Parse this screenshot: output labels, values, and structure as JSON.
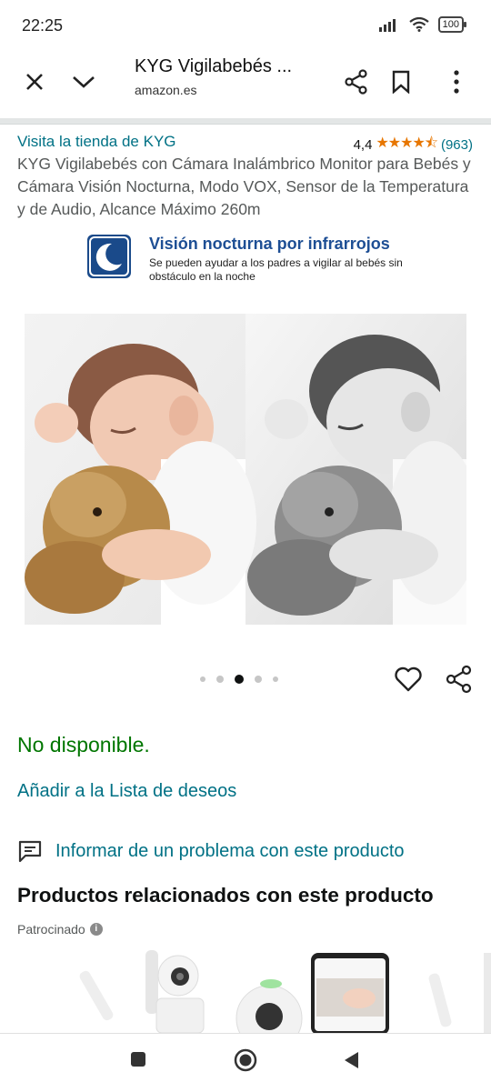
{
  "status_bar": {
    "time": "22:25",
    "battery": "100"
  },
  "browser": {
    "page_title": "KYG Vigilabebés ...",
    "domain": "amazon.es"
  },
  "product": {
    "store_link": "Visita la tienda de KYG",
    "rating_value": "4,4",
    "rating_stars": "★★★★⯪",
    "rating_count": "(963)",
    "title": "KYG Vigilabebés con Cámara Inalámbrico Monitor para Bebés y Cámara Visión Nocturna, Modo VOX, Sensor de la Temperatura y de Audio, Alcance Máximo 260m",
    "banner_heading": "Visión nocturna por infrarrojos",
    "banner_subtext": "Se pueden ayudar a los padres a vigilar al bebés sin obstáculo en la noche",
    "carousel": {
      "count": 5,
      "active_index": 2
    },
    "availability": "No disponible.",
    "wishlist_link": "Añadir a la Lista de deseos",
    "report_link": "Informar de un problema con este producto"
  },
  "related": {
    "heading": "Productos relacionados con este producto",
    "sponsored_label": "Patrocinado",
    "info_glyph": "i"
  },
  "colors": {
    "link": "#007185",
    "available": "#007600",
    "star": "#e77600",
    "banner_blue": "#1d4e94"
  }
}
